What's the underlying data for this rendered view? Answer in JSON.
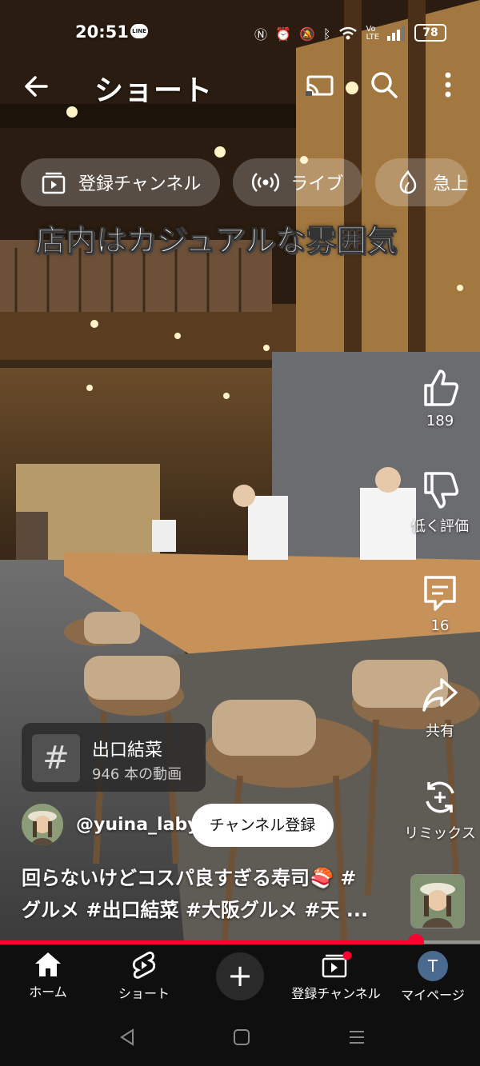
{
  "status": {
    "time": "20:51",
    "battery": "78"
  },
  "topbar": {
    "title": "ショート"
  },
  "chips": [
    {
      "label": "登録チャンネル",
      "icon": "subscriptions-icon"
    },
    {
      "label": "ライブ",
      "icon": "live-icon"
    },
    {
      "label": "急上",
      "icon": "trending-icon"
    }
  ],
  "video": {
    "caption_overlay": "店内はカジュアルな雰囲気"
  },
  "actions": {
    "like_count": "189",
    "dislike_label": "低く評価",
    "comment_count": "16",
    "share_label": "共有",
    "remix_label": "リミックス"
  },
  "hashtag": {
    "title": "出口結菜",
    "subtitle": "946 本の動画"
  },
  "channel": {
    "handle": "@yuina_laby",
    "subscribe_label": "チャンネル登録"
  },
  "description": {
    "line1": "回らないけどコスパ良すぎる寿司🍣 #",
    "line2": "グルメ #出口結菜 #大阪グルメ #天 ..."
  },
  "progress": {
    "fraction": 0.867,
    "color": "#ff0033"
  },
  "nav": {
    "home": "ホーム",
    "shorts": "ショート",
    "subscriptions": "登録チャンネル",
    "mypage": "マイページ",
    "avatar_letter": "T"
  }
}
